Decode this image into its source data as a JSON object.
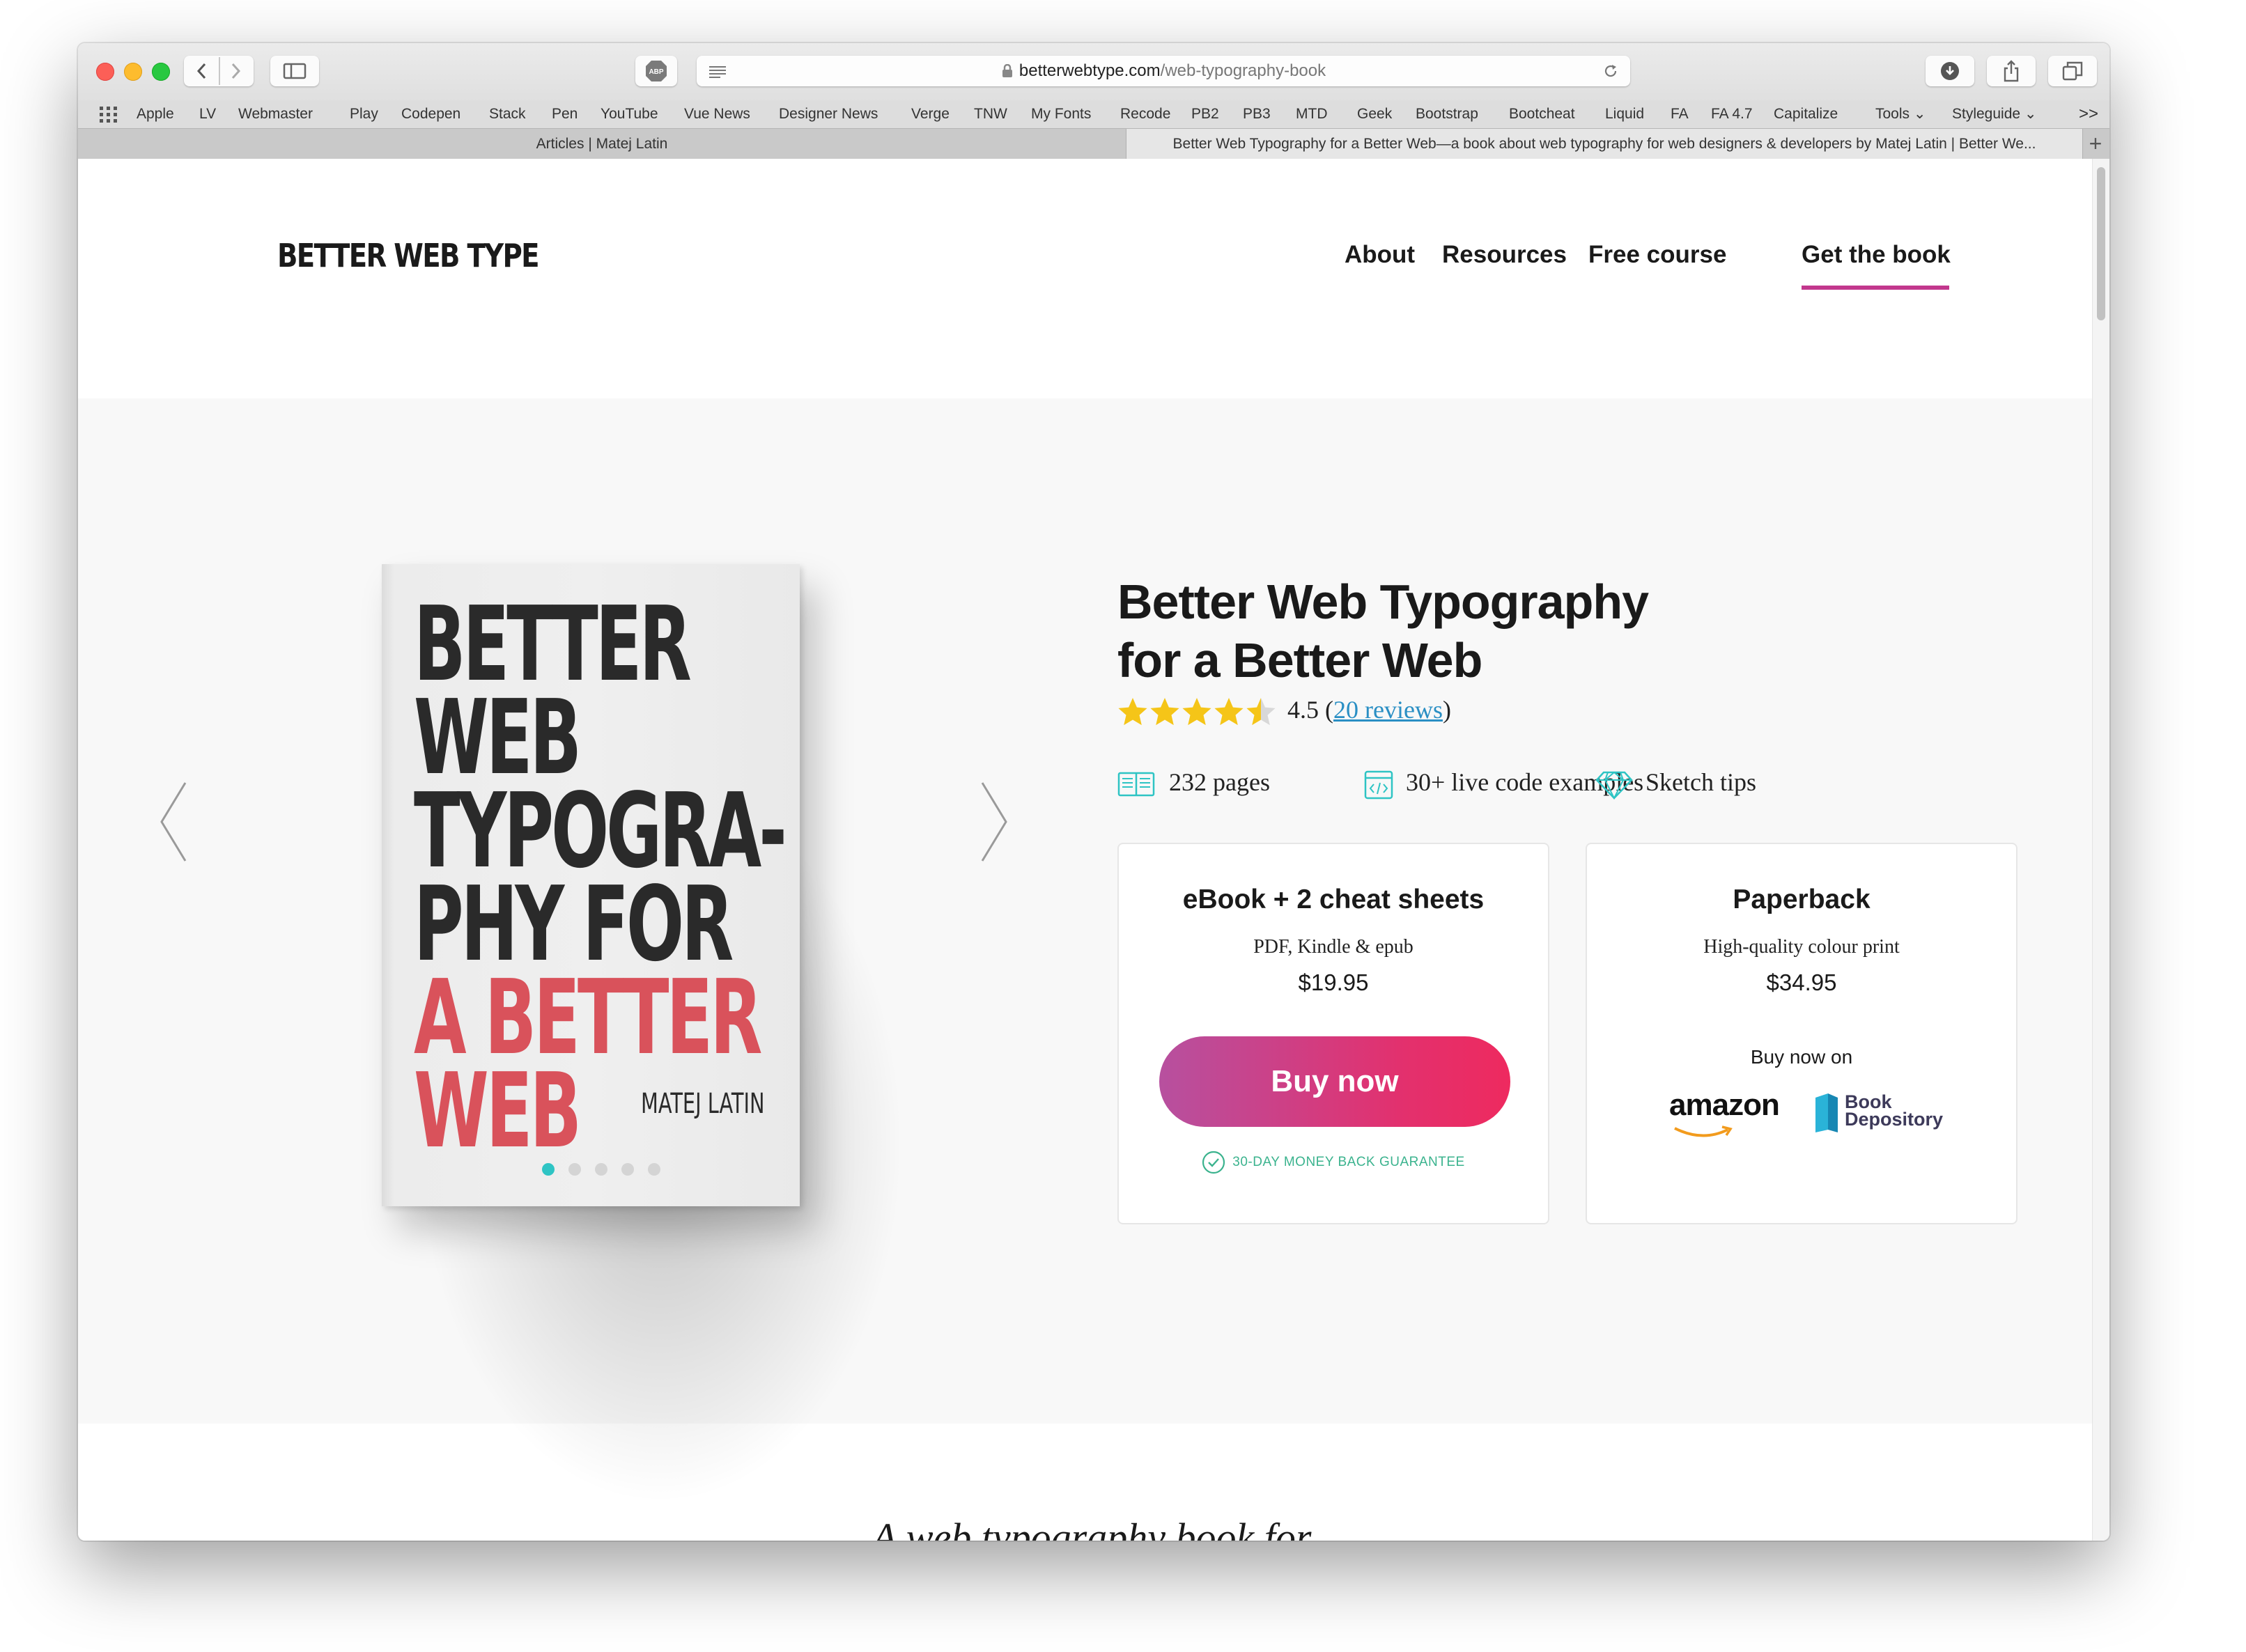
{
  "browser": {
    "url_host": "betterwebtype.com",
    "url_path": "/web-typography-book",
    "bookmarks": [
      "Apple",
      "LV",
      "Webmaster",
      "Play",
      "Codepen",
      "Stack",
      "Pen",
      "YouTube",
      "Vue News",
      "Designer News",
      "Verge",
      "TNW",
      "My Fonts",
      "Recode",
      "PB2",
      "PB3",
      "MTD",
      "Geek",
      "Bootstrap",
      "Bootcheat",
      "Liquid",
      "FA",
      "FA 4.7",
      "Capitalize",
      "Tools ⌄",
      "Styleguide ⌄"
    ],
    "bookmarks_more": ">>",
    "tabs": [
      {
        "label": "Articles | Matej Latin",
        "active": false
      },
      {
        "label": "Better Web Typography for a Better Web—a book about web typography for web designers & developers by Matej Latin | Better We...",
        "active": true
      }
    ]
  },
  "site": {
    "logo": "BETTER WEB TYPE",
    "nav": [
      "About",
      "Resources",
      "Free course",
      "Get the book"
    ],
    "active_nav": "Get the book"
  },
  "book_cover": {
    "title_dark": [
      "BETTER",
      "WEB",
      "TYPOGRA-",
      "PHY FOR"
    ],
    "title_red": [
      "A BETTER",
      "WEB"
    ],
    "author": "MATEJ LATIN",
    "red_color": "#d9525b"
  },
  "carousel": {
    "slide_count": 5,
    "active_index": 0,
    "accent": "#2ec4c4"
  },
  "product": {
    "title_line1": "Better Web Typography",
    "title_line2": "for a Better Web",
    "rating": 4.5,
    "rating_text": "4.5 (",
    "reviews_link": "20 reviews",
    "rating_close": ")",
    "features": [
      "232 pages",
      "30+ live code examples",
      "Sketch tips"
    ]
  },
  "ebook_card": {
    "title": "eBook + 2 cheat sheets",
    "subtitle": "PDF, Kindle & epub",
    "price": "$19.95",
    "button": "Buy now",
    "guarantee": "30-DAY MONEY BACK GUARANTEE"
  },
  "paperback_card": {
    "title": "Paperback",
    "subtitle": "High-quality colour print",
    "price": "$34.95",
    "buy_on": "Buy now on",
    "store1": "amazon",
    "store2_line1": "Book",
    "store2_line2": "Depository"
  },
  "tagline": "A web typography book for",
  "colors": {
    "accent_pink": "#c2378d",
    "button_from": "#b7509f",
    "button_to": "#ee2a5f",
    "star": "#f5c518",
    "teal": "#2ec4c4"
  }
}
